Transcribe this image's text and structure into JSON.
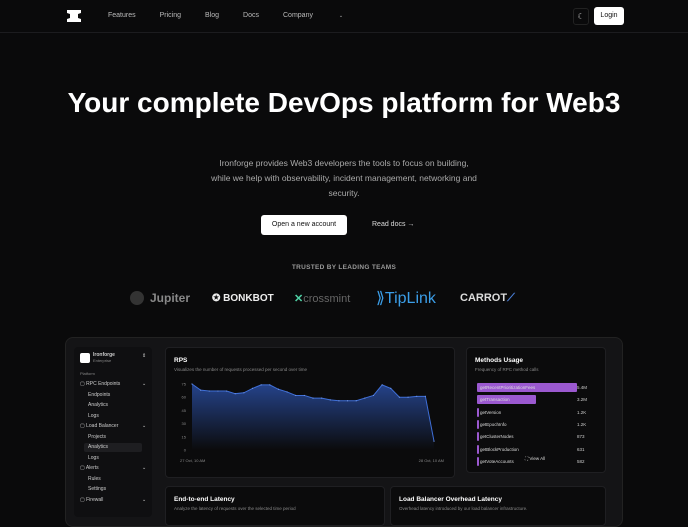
{
  "nav": {
    "links": [
      "Features",
      "Pricing",
      "Blog",
      "Docs",
      "Company"
    ],
    "login": "Login",
    "theme_icon": "moon-icon"
  },
  "hero": {
    "title": "Your complete DevOps platform for Web3",
    "subtitle": "Ironforge provides Web3 developers the tools to focus on building, while we help with observability, incident management, networking and security.",
    "primary_cta": "Open a new account",
    "secondary_cta": "Read docs"
  },
  "trusted": {
    "label": "TRUSTED BY LEADING TEAMS",
    "logos": [
      "Jupiter",
      "BONKBOT",
      "crossmint",
      "TipLink",
      "CARROT"
    ]
  },
  "dashboard": {
    "org": {
      "name": "Ironforge",
      "plan": "Enterprise"
    },
    "section": "Platform",
    "sidebar": [
      {
        "label": "RPC Endpoints",
        "children": [
          "Endpoints",
          "Analytics",
          "Logs"
        ]
      },
      {
        "label": "Load Balancer",
        "children": [
          "Projects",
          "Analytics",
          "Logs"
        ]
      },
      {
        "label": "Alerts",
        "children": [
          "Rules",
          "Settings"
        ]
      },
      {
        "label": "Firewall",
        "children": []
      }
    ],
    "rps": {
      "title": "RPS",
      "subtitle": "Visualizes the number of requests processed per second over time",
      "x_start": "27 Oct, 10 AM",
      "x_end": "28 Oct, 10 AM"
    },
    "methods": {
      "title": "Methods Usage",
      "subtitle": "Frequency of RPC method calls",
      "view_all": "View All",
      "rows": [
        {
          "name": "getRecentPrioritizationFees",
          "value": "5.4M",
          "frac": 1
        },
        {
          "name": "getTransaction",
          "value": "3.2M",
          "frac": 0.59
        },
        {
          "name": "getVersion",
          "value": "1.2K",
          "frac": 0.01
        },
        {
          "name": "getEpochInfo",
          "value": "1.2K",
          "frac": 0.01
        },
        {
          "name": "getClusterNodes",
          "value": "873",
          "frac": 0.01
        },
        {
          "name": "getBlockProduction",
          "value": "631",
          "frac": 0.01
        },
        {
          "name": "getVoteAccounts",
          "value": "582",
          "frac": 0.01
        }
      ]
    },
    "latency": {
      "title": "End-to-end Latency",
      "subtitle": "Analyze the latency of requests over the selected time period"
    },
    "lb_latency": {
      "title": "Load Balancer Overhead Latency",
      "subtitle": "Overhead latency introduced by our load balancer infrastructure."
    }
  },
  "chart_data": {
    "type": "area",
    "title": "RPS",
    "ylim": [
      0,
      75
    ],
    "yticks": [
      0,
      15,
      30,
      45,
      60,
      75
    ],
    "x_labels": [
      "27 Oct, 10 AM",
      "28 Oct, 10 AM"
    ],
    "values": [
      75,
      68,
      67,
      67,
      67,
      64,
      65,
      70,
      74,
      74,
      69,
      66,
      62,
      62,
      59,
      59,
      57,
      56,
      56,
      56,
      59,
      62,
      74,
      70,
      60,
      60,
      61,
      61,
      10
    ]
  }
}
